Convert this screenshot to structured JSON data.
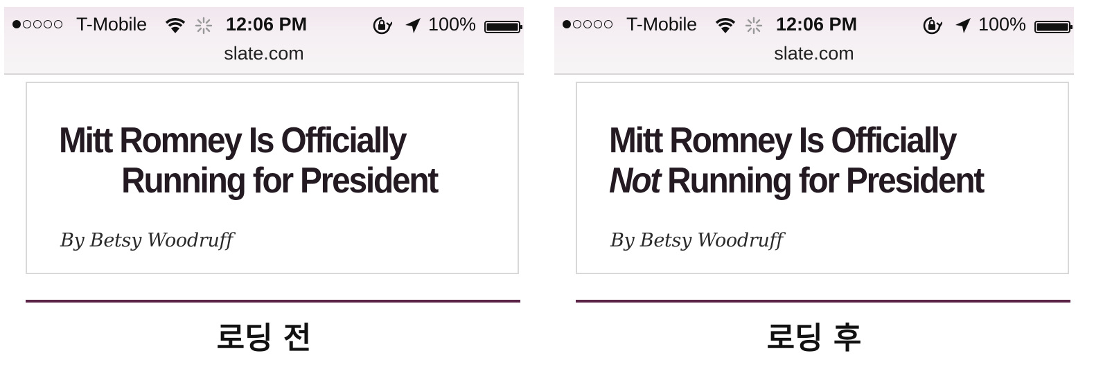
{
  "screens": [
    {
      "status_bar": {
        "signal_bars_filled": 1,
        "signal_bars_total": 5,
        "carrier": "T-Mobile",
        "wifi_icon": "wifi-icon",
        "activity_icon": "network-activity-icon",
        "time": "12:06 PM",
        "rotation_lock_icon": "rotation-lock-icon",
        "location_icon": "location-arrow-icon",
        "battery_percent": "100%",
        "battery_icon": "battery-full-icon"
      },
      "url": "slate.com",
      "article": {
        "headline_line1": "Mitt Romney Is Officially",
        "headline_line2_em": "",
        "headline_line2": "Running for President",
        "byline": "By Betsy Woodruff"
      },
      "caption": "로딩 전"
    },
    {
      "status_bar": {
        "signal_bars_filled": 1,
        "signal_bars_total": 5,
        "carrier": "T-Mobile",
        "wifi_icon": "wifi-icon",
        "activity_icon": "network-activity-icon",
        "time": "12:06 PM",
        "rotation_lock_icon": "rotation-lock-icon",
        "location_icon": "location-arrow-icon",
        "battery_percent": "100%",
        "battery_icon": "battery-full-icon"
      },
      "url": "slate.com",
      "article": {
        "headline_line1": "Mitt Romney Is Officially",
        "headline_line2_em": "Not",
        "headline_line2": " Running for President",
        "byline": "By Betsy Woodruff"
      },
      "caption": "로딩 후"
    }
  ],
  "colors": {
    "accent_rule": "#5b2345",
    "headline": "#231a22"
  }
}
